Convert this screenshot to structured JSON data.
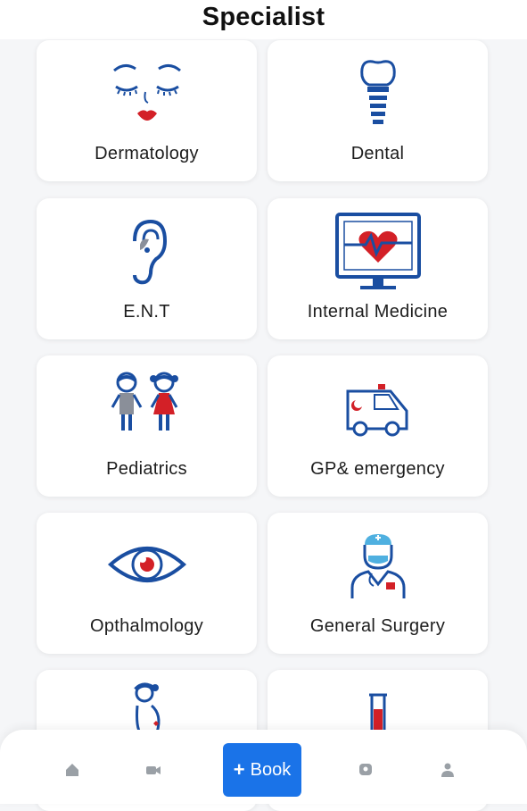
{
  "header": {
    "title": "Specialist"
  },
  "specialties": [
    {
      "label": "Dermatology",
      "icon": "face-icon"
    },
    {
      "label": "Dental",
      "icon": "tooth-implant-icon"
    },
    {
      "label": "E.N.T",
      "icon": "ear-icon"
    },
    {
      "label": "Internal Medicine",
      "icon": "heart-monitor-icon"
    },
    {
      "label": "Pediatrics",
      "icon": "children-icon"
    },
    {
      "label": "GP& emergency",
      "icon": "ambulance-icon"
    },
    {
      "label": "Opthalmology",
      "icon": "eye-icon"
    },
    {
      "label": "General Surgery",
      "icon": "surgeon-icon"
    },
    {
      "label": "",
      "icon": "pregnant-woman-icon"
    },
    {
      "label": "",
      "icon": "test-tube-icon"
    }
  ],
  "bottom_nav": {
    "book_label": "Book",
    "items": [
      "home-icon",
      "video-icon",
      "chat-icon",
      "profile-icon"
    ]
  },
  "colors": {
    "primary_blue": "#1a4ea1",
    "accent_red": "#d32027",
    "button_blue": "#1a73e8"
  }
}
